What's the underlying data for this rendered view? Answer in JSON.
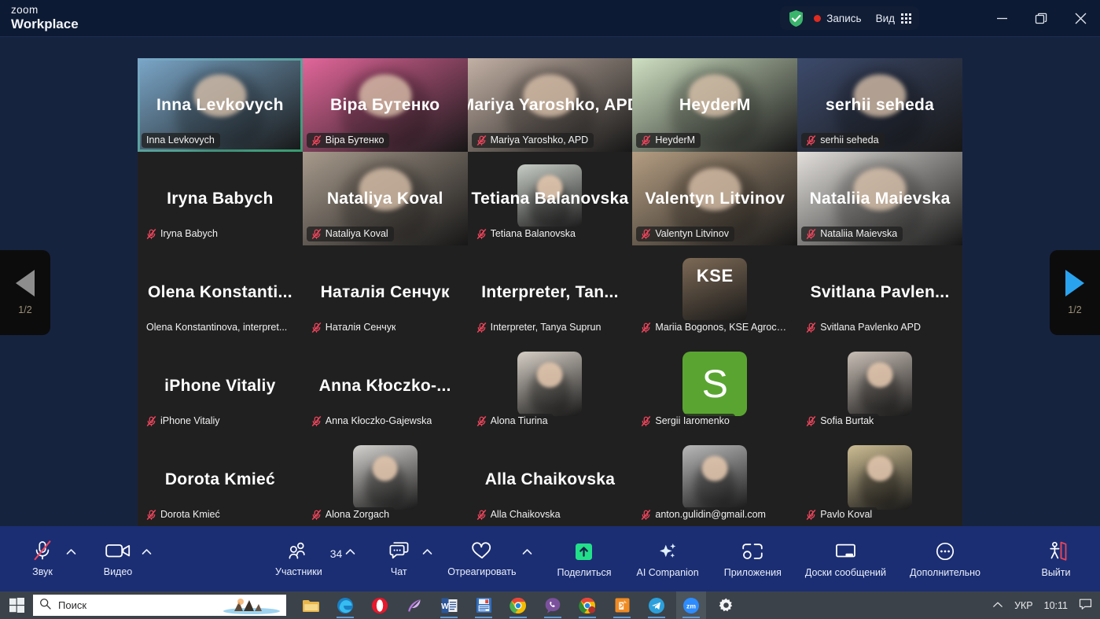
{
  "titlebar": {
    "logo_line1": "zoom",
    "logo_line2": "Workplace",
    "shield_icon": "shield-check-icon",
    "recording_label": "Запись",
    "view_label": "Вид",
    "view_icon": "grid-icon",
    "minimize_icon": "minimize-icon",
    "maximize_icon": "restore-icon",
    "close_icon": "close-icon"
  },
  "gallery": {
    "rows": 5,
    "cols": 5,
    "active_speaker": "Inna Levkovych",
    "tiles": [
      {
        "name": "Inna Levkovych",
        "display": "Inna Levkovych",
        "mode": "video",
        "muted": false,
        "active": true,
        "bg": "#7ba7c9"
      },
      {
        "name": "Віра Бутенко",
        "display": "Віра Бутенко",
        "mode": "video",
        "muted": true,
        "active": false,
        "bg": "#e2669a"
      },
      {
        "name": "Mariya Yaroshko, APD",
        "display": "Mariya Yaroshko, APD",
        "mode": "video",
        "muted": true,
        "active": false,
        "bg": "#c2b0a4"
      },
      {
        "name": "HeyderM",
        "display": "HeyderM",
        "mode": "video",
        "muted": true,
        "active": false,
        "bg": "#cfe0c2"
      },
      {
        "name": "serhii seheda",
        "display": "serhii seheda",
        "mode": "video",
        "muted": true,
        "active": false,
        "bg": "#3c4a6b"
      },
      {
        "name": "Iryna Babych",
        "display": "Iryna Babych",
        "mode": "name",
        "muted": true,
        "active": false
      },
      {
        "name": "Nataliya Koval",
        "display": "Nataliya Koval",
        "mode": "video",
        "muted": true,
        "active": false,
        "bg": "#a79a8c"
      },
      {
        "name": "Tetiana Balanovska",
        "display": "Tetiana Balanovska",
        "mode": "photo",
        "muted": true,
        "active": false,
        "bg": "#c8cdc6"
      },
      {
        "name": "Valentyn Litvinov",
        "display": "Valentyn Litvinov",
        "mode": "video",
        "muted": true,
        "active": false,
        "bg": "#b49d82"
      },
      {
        "name": "Nataliia Maievska",
        "display": "Nataliia Maievska",
        "mode": "video",
        "muted": true,
        "active": false,
        "bg": "#e3e0dc"
      },
      {
        "name": "Olena Konstantinova, interpret...",
        "display": "Olena  Konstanti...",
        "mode": "name",
        "muted": false,
        "active": false
      },
      {
        "name": "Наталія Сенчук",
        "display": "Наталія Сенчук",
        "mode": "name",
        "muted": true,
        "active": false
      },
      {
        "name": "Interpreter, Tanya Suprun",
        "display": "Interpreter,  Tan...",
        "mode": "name",
        "muted": true,
        "active": false
      },
      {
        "name": "Mariia Bogonos, KSE Agroce...",
        "display": "",
        "mode": "photo",
        "muted": true,
        "active": false,
        "bg": "#7d6a56",
        "avatar_text": "KSE"
      },
      {
        "name": "Svitlana Pavlenko APD",
        "display": "Svitlana  Pavlen...",
        "mode": "name",
        "muted": true,
        "active": false
      },
      {
        "name": "iPhone Vitaliy",
        "display": "iPhone Vitaliy",
        "mode": "name",
        "muted": true,
        "active": false
      },
      {
        "name": "Anna Kłoczko-Gajewska",
        "display": "Anna  Kłoczko-...",
        "mode": "name",
        "muted": true,
        "active": false
      },
      {
        "name": "Alona Tiurina",
        "display": "",
        "mode": "photo",
        "muted": true,
        "active": false,
        "bg": "#d6cfc6"
      },
      {
        "name": "Sergii Iaromenko",
        "display": "",
        "mode": "initial",
        "muted": true,
        "active": false,
        "bg": "#5aa531",
        "avatar_text": "S"
      },
      {
        "name": "Sofia Burtak",
        "display": "",
        "mode": "photo",
        "muted": true,
        "active": false,
        "bg": "#c9bfb6"
      },
      {
        "name": "Dorota Kmieć",
        "display": "Dorota Kmieć",
        "mode": "name",
        "muted": true,
        "active": false
      },
      {
        "name": "Alona Zorgach",
        "display": "",
        "mode": "photo",
        "muted": true,
        "active": false,
        "bg": "#d4d2cf"
      },
      {
        "name": "Alla Chaikovska",
        "display": "Alla Chaikovska",
        "mode": "name",
        "muted": true,
        "active": false
      },
      {
        "name": "anton.gulidin@gmail.com",
        "display": "",
        "mode": "photo",
        "muted": true,
        "active": false,
        "bg": "#b9b9b9"
      },
      {
        "name": "Pavlo Koval",
        "display": "",
        "mode": "photo",
        "muted": true,
        "active": false,
        "bg": "#cdbd93"
      }
    ]
  },
  "pagenav": {
    "prev_icon": "chevron-left-icon",
    "next_icon": "chevron-right-icon",
    "prev_label": "1/2",
    "next_label": "1/2"
  },
  "toolbar": {
    "audio": {
      "label": "Звук",
      "icon": "microphone-muted-icon",
      "caret": true,
      "muted": true
    },
    "video": {
      "label": "Видео",
      "icon": "camera-icon",
      "caret": true
    },
    "participants": {
      "label": "Участники",
      "icon": "participants-icon",
      "count": "34",
      "caret": true
    },
    "chat": {
      "label": "Чат",
      "icon": "chat-icon",
      "caret": true
    },
    "react": {
      "label": "Отреагировать",
      "icon": "heart-icon",
      "caret": true
    },
    "share": {
      "label": "Поделиться",
      "icon": "share-screen-icon",
      "accent": "#22e08a"
    },
    "ai": {
      "label": "AI Companion",
      "icon": "sparkle-icon"
    },
    "apps": {
      "label": "Приложения",
      "icon": "apps-icon"
    },
    "whiteboards": {
      "label": "Доски сообщений",
      "icon": "whiteboard-icon"
    },
    "more": {
      "label": "Дополнительно",
      "icon": "ellipsis-icon"
    },
    "leave": {
      "label": "Выйти",
      "icon": "leave-meeting-icon",
      "accent": "#e8455a"
    }
  },
  "taskbar": {
    "start_icon": "windows-start-icon",
    "search_placeholder": "Поиск",
    "search_icon": "search-icon",
    "apps": [
      {
        "name": "file-explorer-icon"
      },
      {
        "name": "edge-icon"
      },
      {
        "name": "opera-icon"
      },
      {
        "name": "paint-feather-icon"
      },
      {
        "name": "word-icon"
      },
      {
        "name": "excel-icon"
      },
      {
        "name": "chrome-icon"
      },
      {
        "name": "viber-icon"
      },
      {
        "name": "chrome-beta-icon"
      },
      {
        "name": "pdf-doc-icon"
      },
      {
        "name": "telegram-icon"
      },
      {
        "name": "zoom-icon"
      },
      {
        "name": "settings-gear-icon"
      }
    ],
    "tray": {
      "chevron_icon": "chevron-up-icon",
      "language": "УКР",
      "clock": "10:11",
      "notification_icon": "notification-icon"
    }
  }
}
